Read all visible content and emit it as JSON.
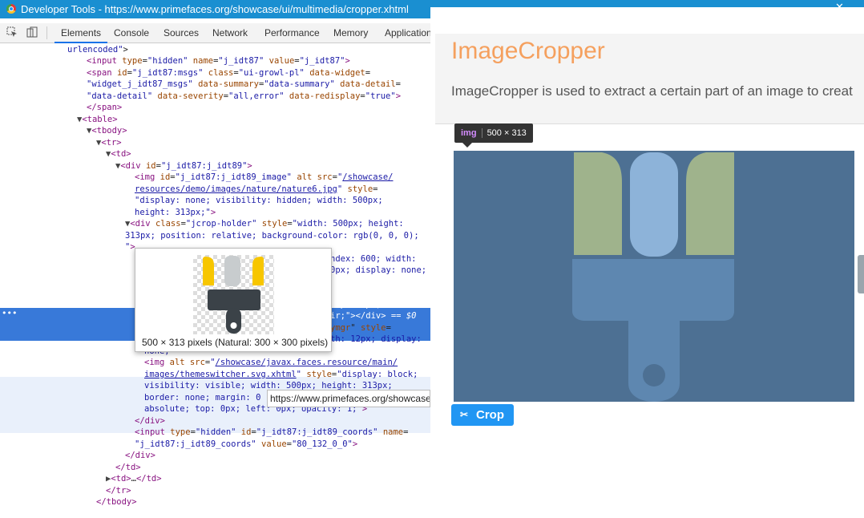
{
  "window": {
    "title": "Developer Tools - https://www.primefaces.org/showcase/ui/multimedia/cropper.xhtml",
    "minimize": "–",
    "close": "✕"
  },
  "devtools": {
    "tabs": [
      "Elements",
      "Console",
      "Sources",
      "Network",
      "Performance",
      "Memory",
      "Application"
    ],
    "active_tab": "Elements",
    "image_tooltip_caption": "500 × 313 pixels (Natural: 300 × 300 pixels)",
    "url_tooltip": "https://www.primefaces.org/showcase",
    "selected_marker": "== $0"
  },
  "page": {
    "title": "ImageCropper",
    "description": "ImageCropper is used to extract a certain part of an image to creat",
    "badge_tag": "img",
    "badge_size": "500 × 313",
    "crop_button": "Crop"
  },
  "colors": {
    "accent": "#1a8fd1",
    "title_orange": "#f5a05e",
    "button_blue": "#2196f3",
    "image_bg": "#4d7093",
    "brush_green": "#9fb38c",
    "brush_blue": "#8db3d9",
    "brush_handle": "#5e87b0",
    "thumb_yellow": "#f7c600",
    "thumb_gray": "#c8ccce",
    "thumb_dark": "#3b4248",
    "selection": "#3879d9"
  }
}
